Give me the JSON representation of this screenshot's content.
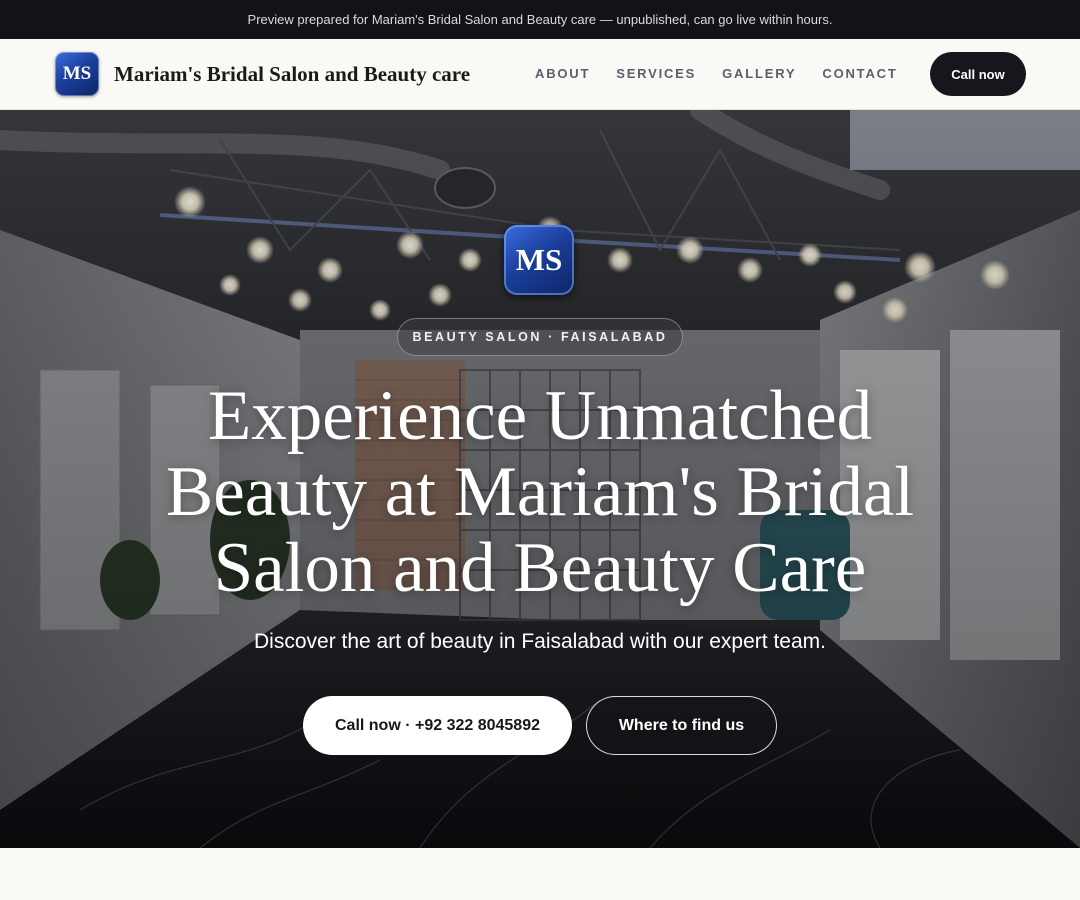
{
  "banner": {
    "text": "Preview prepared for Mariam's Bridal Salon and Beauty care — unpublished, can go live within hours."
  },
  "nav": {
    "logo_initials": "MS",
    "brand_name": "Mariam's Bridal Salon and Beauty care",
    "links": [
      "ABOUT",
      "SERVICES",
      "GALLERY",
      "CONTACT"
    ],
    "call_label": "Call now"
  },
  "hero": {
    "logo_initials": "MS",
    "tagline": "BEAUTY SALON · FAISALABAD",
    "headline": "Experience Unmatched Beauty at Mariam's Bridal Salon and Beauty Care",
    "subheadline": "Discover the art of beauty in Faisalabad with our expert team.",
    "primary_cta": "Call now · +92 322 8045892",
    "secondary_cta": "Where to find us"
  },
  "colors": {
    "banner_bg": "#111318",
    "nav_bg": "#faf9f6",
    "call_button_bg": "#15171c",
    "logo_blue": "#1b3f9c"
  }
}
